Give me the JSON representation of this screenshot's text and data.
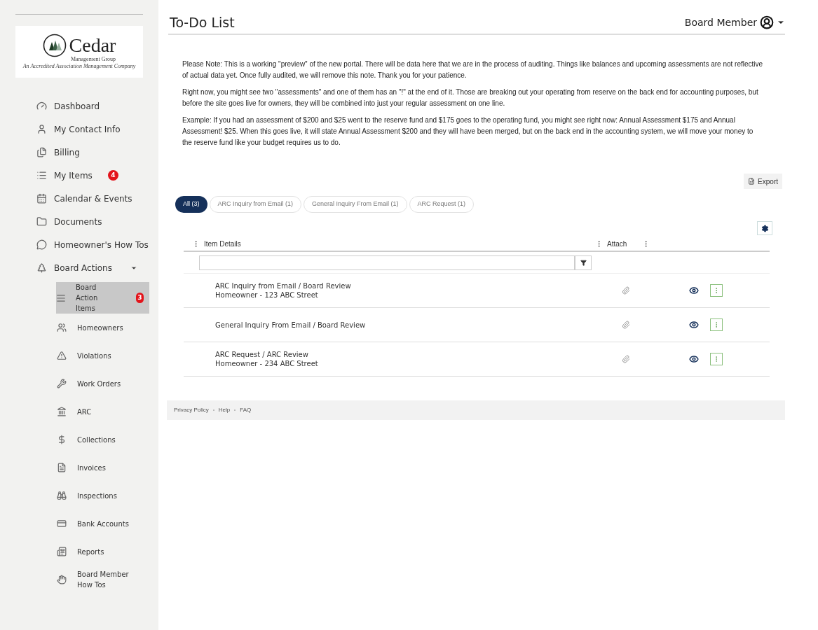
{
  "logo": {
    "name": "Cedar",
    "subtitle": "Management Group",
    "tagline": "An Accredited Association Management Company"
  },
  "sidebar": {
    "items": [
      {
        "label": "Dashboard"
      },
      {
        "label": "My Contact Info"
      },
      {
        "label": "Billing"
      },
      {
        "label": "My Items",
        "badge": "4"
      },
      {
        "label": "Calendar & Events"
      },
      {
        "label": "Documents"
      },
      {
        "label": "Homeowner's How Tos"
      },
      {
        "label": "Board Actions",
        "expanded": true,
        "children": [
          {
            "label": "Board Action Items",
            "badge": "3",
            "selected": true
          },
          {
            "label": "Homeowners",
            "selected": false
          },
          {
            "label": "Violations",
            "selected": false
          },
          {
            "label": "Work Orders",
            "selected": false
          },
          {
            "label": "ARC",
            "selected": false
          },
          {
            "label": "Collections",
            "selected": false
          },
          {
            "label": "Invoices",
            "selected": false
          },
          {
            "label": "Inspections",
            "selected": false
          },
          {
            "label": "Bank Accounts",
            "selected": false
          },
          {
            "label": "Reports",
            "selected": false
          },
          {
            "label": "Board Member How Tos",
            "selected": false
          }
        ]
      }
    ]
  },
  "header": {
    "title": "To-Do List",
    "user": "Board Member"
  },
  "notes": [
    "Please Note:   This is a working \"preview\" of the new portal.  There will be data here that we are in the process of auditing. Things like balances and upcoming assessments are not reflective of actual data yet. Once fully audited, we will remove this note. Thank you for your patience.",
    "Right now, you might see two \"assessments\" and one of them has an \"!\" at the end of it.  Those are breaking out your operating from reserve on the back end for accounting purposes, but before the site goes live for owners, they will be combined into just your regular assessment on one line.",
    "Example:  If you had an assessment of $200 and $25 went to the reserve fund and $175 goes to the operating fund, you might see right now:  Annual Assessment $175 and Annual Assessment! $25.   When this goes live, it will state Annual Assessment $200 and they will have been merged, but on the back end in the accounting system, we will move your money to the reserve fund like your budget requires us to do."
  ],
  "export": "Export",
  "tabs": [
    {
      "label": "All (3)",
      "selected": true
    },
    {
      "label": "ARC Inquiry from Email (1)",
      "selected": false
    },
    {
      "label": "General Inquiry From Email (1)",
      "selected": false
    },
    {
      "label": "ARC Request (1)",
      "selected": false
    }
  ],
  "table": {
    "columns": [
      "Item Details",
      "Attach"
    ],
    "rows": [
      {
        "title": "ARC Inquiry from Email / Board Review",
        "subtitle": "Homeowner - 123 ABC Street"
      },
      {
        "title": "General Inquiry From Email / Board Review"
      },
      {
        "title": "ARC Request / ARC Review",
        "subtitle": "Homeowner - 234 ABC Street"
      }
    ]
  },
  "footer": [
    "Privacy Policy",
    "Help",
    "FAQ"
  ]
}
